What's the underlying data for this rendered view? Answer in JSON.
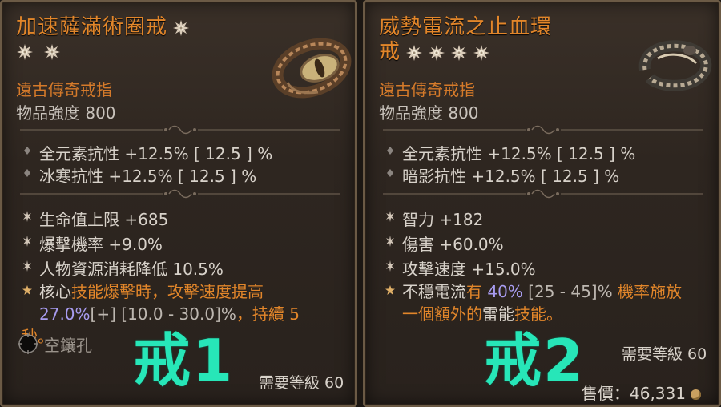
{
  "card1": {
    "title": "加速薩滿術圈戒",
    "subtype": "遠古傳奇戒指",
    "item_power": "物品強度 800",
    "implicits": [
      "全元素抗性 +12.5%  [ 12.5 ] %",
      "冰寒抗性 +12.5%  [ 12.5 ] %"
    ],
    "affixes": [
      "生命值上限 +685",
      "爆擊機率 +9.0%",
      "人物資源消耗降低 10.5%"
    ],
    "legendary": {
      "p1": "核心",
      "p2": "技能",
      "p3": "爆擊時，攻擊速度提高",
      "p4": "27.0%",
      "p5": "[+] [10.0 - 30.0]%",
      "p6": "，持續 5 秒。"
    },
    "socket_label": "空鑲孔",
    "requirement": "需要等級 60",
    "overlay": "戒1"
  },
  "card2": {
    "title_line1": "威勢電流之止血環",
    "title_line2": "戒",
    "subtype": "遠古傳奇戒指",
    "item_power": "物品強度 800",
    "implicits": [
      "全元素抗性 +12.5%  [ 12.5 ] %",
      "暗影抗性 +12.5%  [ 12.5 ] %"
    ],
    "affixes": [
      "智力 +182",
      "傷害 +60.0%",
      "攻擊速度 +15.0%"
    ],
    "legendary": {
      "p1": "不穩電流",
      "p2": "有 ",
      "p3": "40%",
      "p4": " [25 - 45]%",
      "p5": " 機率施放",
      "p6": "一個額外的",
      "p7": "雷能",
      "p8": "技能",
      "p9": "。"
    },
    "requirement": "需要等級 60",
    "price": "售價：46,331",
    "overlay": "戒2"
  },
  "colors": {
    "legendary_orange": "#e2862a",
    "roll_purple": "#a89cf0",
    "overlay_teal": "#27e6b8"
  },
  "icons": [
    "star-icon",
    "ring-icon",
    "diamond-bullet-icon",
    "star-bullet-icon",
    "socket-icon",
    "gold-coin-icon"
  ]
}
